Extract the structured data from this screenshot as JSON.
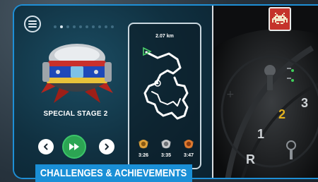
{
  "stage": {
    "name": "SPECIAL STAGE 2",
    "carousel_total": 10,
    "carousel_active": 1
  },
  "track": {
    "distance": "2.07 km"
  },
  "medals": [
    {
      "tier": "gold",
      "time": "3:26",
      "color": "#e0a23a"
    },
    {
      "tier": "silver",
      "time": "3:35",
      "color": "#c7c9cc"
    },
    {
      "tier": "bronze",
      "time": "3:47",
      "color": "#e07a2f"
    }
  ],
  "dashboard": {
    "gear_labels": [
      "3",
      "2",
      "1",
      "R"
    ],
    "highlighted_gear": "2"
  },
  "banner": {
    "text": "CHALLENGES & ACHIEVEMENTS"
  },
  "icons": {
    "menu": "hamburger-menu-icon",
    "prev": "chevron-left-icon",
    "next": "chevron-right-icon",
    "play": "fast-forward-icon",
    "badge": "space-invader-icon"
  },
  "colors": {
    "accent": "#1a8fd6",
    "play": "#2ca553",
    "badge": "#c5332b",
    "highlight_gear": "#e3b21f"
  }
}
